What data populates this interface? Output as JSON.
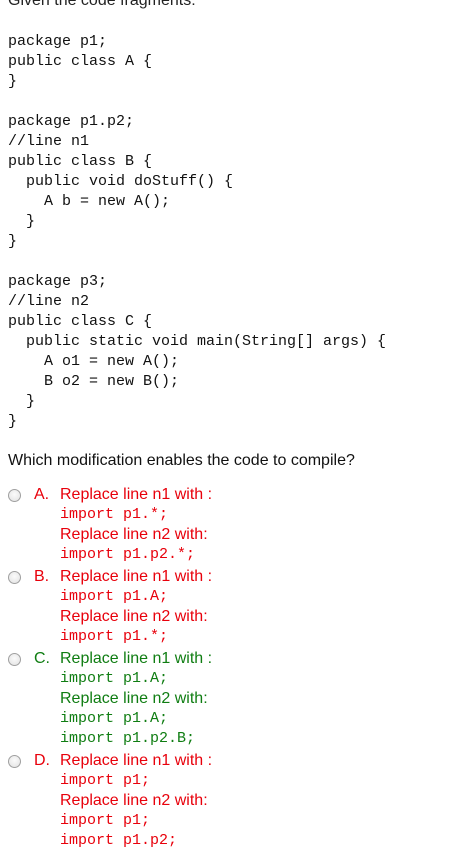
{
  "intro": "Given the code fragments:",
  "code_blocks": [
    {
      "lines": [
        "package p1;",
        "public class A {",
        "}"
      ]
    },
    {
      "lines": [
        "package p1.p2;",
        "//line n1",
        "public class B {",
        "  public void doStuff() {",
        "    A b = new A();",
        "  }",
        "}"
      ]
    },
    {
      "lines": [
        "package p3;",
        "//line n2",
        "public class C {",
        "  public static void main(String[] args) {",
        "    A o1 = new A();",
        "    B o2 = new B();",
        "  }",
        "}"
      ]
    }
  ],
  "question": "Which modification enables the code to compile?",
  "options": [
    {
      "letter": "A.",
      "color": "#e8000b",
      "lines": [
        "Replace line n1 with :",
        "import p1.*;",
        "Replace line n2 with:",
        "import p1.p2.*;"
      ]
    },
    {
      "letter": "B.",
      "color": "#e8000b",
      "lines": [
        "Replace line n1 with :",
        "import p1.A;",
        "Replace line n2 with:",
        "import p1.*;"
      ]
    },
    {
      "letter": "C.",
      "color": "#0f7d12",
      "lines": [
        "Replace line n1 with :",
        "import p1.A;",
        "Replace line n2 with:",
        "import p1.A;",
        "import p1.p2.B;"
      ]
    },
    {
      "letter": "D.",
      "color": "#e8000b",
      "lines": [
        "Replace line n1 with :",
        "import p1;",
        "Replace line n2 with:",
        "import p1;",
        "import p1.p2;"
      ]
    }
  ]
}
